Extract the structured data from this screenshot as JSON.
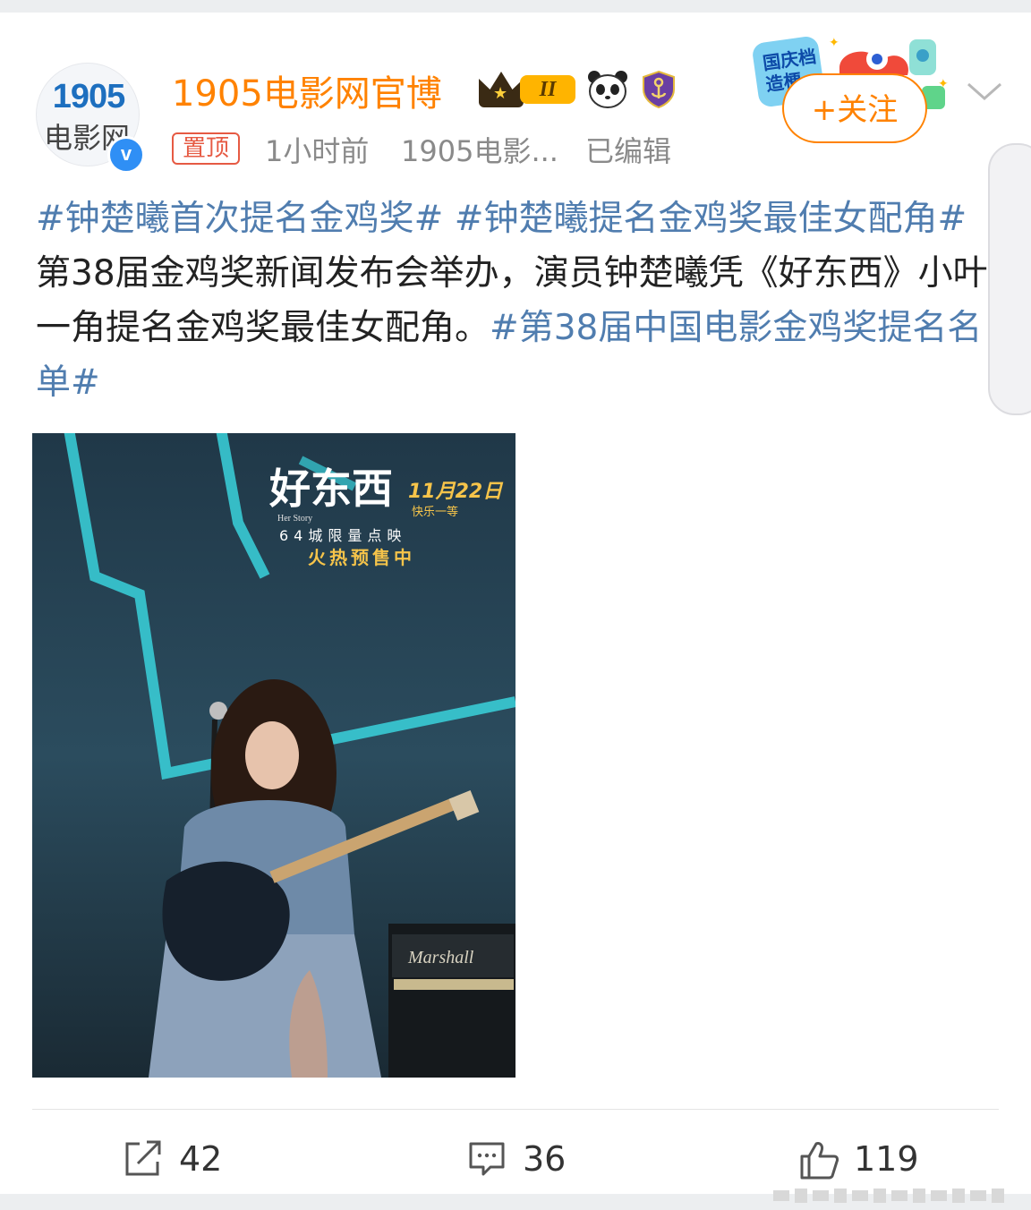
{
  "post": {
    "avatar": {
      "logo_number": "1905",
      "logo_text": "电影网",
      "verified_mark": "v"
    },
    "author": {
      "name": "1905电影网官博",
      "level_badge": "II",
      "badge_icons": [
        "crown-icon",
        "panda-icon",
        "anchor-shield-icon"
      ]
    },
    "pinned_label": "置顶",
    "time": "1小时前",
    "source": "1905电影...",
    "edited": "已编辑",
    "follow_label": "+关注",
    "promo_sticker_text": "国庆档造梗",
    "text": {
      "segments": [
        {
          "text": "#钟楚曦首次提名金鸡奖#",
          "kind": "hashtag"
        },
        {
          "text": " ",
          "kind": "plain"
        },
        {
          "text": "#钟楚曦提名金鸡奖最佳女配角#",
          "kind": "hashtag"
        },
        {
          "text": " 第38届金鸡奖新闻发布会举办，演员钟楚曦凭《好东西》小叶一角提名金鸡奖最佳女配角。",
          "kind": "plain"
        },
        {
          "text": "#第38届中国电影金鸡奖提名名单#",
          "kind": "hashtag"
        }
      ]
    },
    "image": {
      "poster_title": "好东西",
      "poster_subtitle": "Her Story",
      "release_date": "11月22日",
      "release_tagline": "快乐一等",
      "screening_note": "64城限量点映",
      "presale": "火热预售中",
      "amp_brand": "Marshall"
    },
    "actions": {
      "repost_count": "42",
      "comment_count": "36",
      "like_count": "119"
    },
    "colors": {
      "accent_orange": "#ff8200",
      "hashtag_blue": "#507daf",
      "pinned_red": "#e65a43",
      "meta_gray": "#8a8a8a"
    }
  }
}
